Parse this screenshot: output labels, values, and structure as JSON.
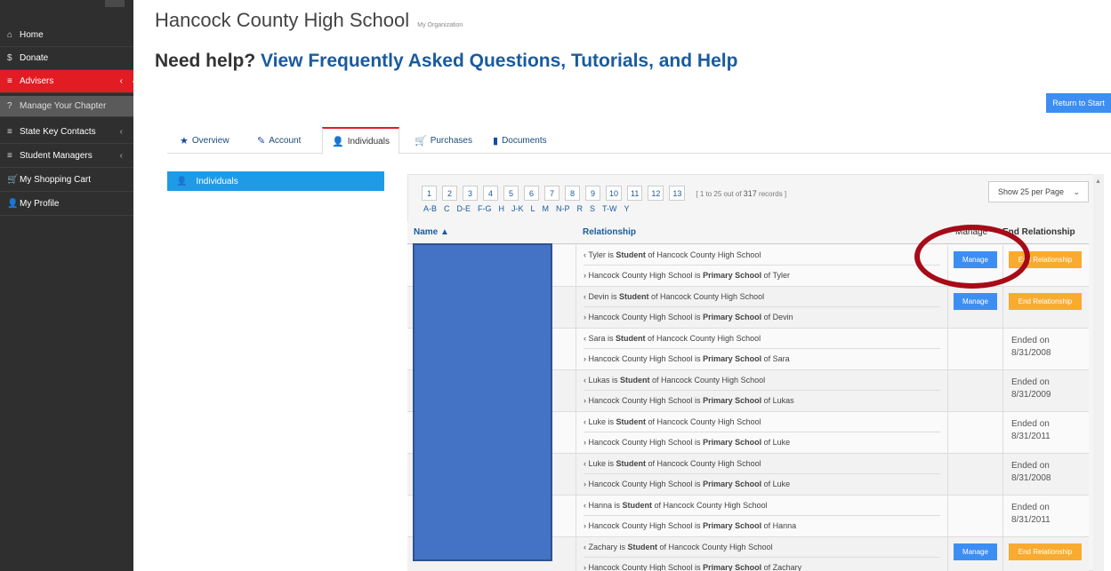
{
  "sidebar": {
    "items": [
      {
        "label": "Home",
        "icon": "home-icon",
        "glyph": "⌂"
      },
      {
        "label": "Donate",
        "icon": "dollar-icon",
        "glyph": "$"
      },
      {
        "label": "Advisers",
        "icon": "menu-icon",
        "glyph": "≡"
      },
      {
        "label": "Manage Your Chapter",
        "icon": "help-circle-icon",
        "glyph": "?"
      },
      {
        "label": "State Key Contacts",
        "icon": "menu-icon",
        "glyph": "≡"
      },
      {
        "label": "Student Managers",
        "icon": "menu-icon",
        "glyph": "≡"
      },
      {
        "label": "My Shopping Cart",
        "icon": "cart-icon",
        "glyph": "🛒"
      },
      {
        "label": "My Profile",
        "icon": "user-icon",
        "glyph": "👤"
      }
    ],
    "caret": "‹"
  },
  "header": {
    "org": "Hancock County High School",
    "org_sub": "My Organization",
    "help_prefix": "Need help?",
    "help_link": "View Frequently Asked Questions, Tutorials, and Help",
    "return_btn": "Return to Start"
  },
  "tabs": [
    {
      "label": "Overview",
      "icon": "star-icon",
      "glyph": "★"
    },
    {
      "label": "Account",
      "icon": "edit-icon",
      "glyph": "✎"
    },
    {
      "label": "Individuals",
      "icon": "user-icon",
      "glyph": "👤"
    },
    {
      "label": "Purchases",
      "icon": "cart-icon",
      "glyph": "🛒"
    },
    {
      "label": "Documents",
      "icon": "documents-icon",
      "glyph": "▮"
    }
  ],
  "left_panel": {
    "label": "Individuals",
    "icon": "user-icon",
    "glyph": "👤"
  },
  "pager": {
    "pages": [
      "1",
      "2",
      "3",
      "4",
      "5",
      "6",
      "7",
      "8",
      "9",
      "10",
      "11",
      "12",
      "13"
    ],
    "info_prefix": "[ 1 to 25",
    "info_mid": " out of ",
    "total": "317",
    "info_suffix": " records ]",
    "alpha": [
      "A-B",
      "C",
      "D-E",
      "F-G",
      "H",
      "J-K",
      "L",
      "M",
      "N-P",
      "R",
      "S",
      "T-W",
      "Y"
    ]
  },
  "select": {
    "value": "Show 25 per Page",
    "icon": "chevron-down-icon"
  },
  "table": {
    "headers": {
      "name": "Name ▲",
      "relationship": "Relationship",
      "manage": "Manage",
      "end": "End Relationship"
    },
    "manage_label": "Manage",
    "end_label": "End Relationship",
    "rows": [
      {
        "l1a": "‹ Tyler is ",
        "l1b": "Student",
        "l1c": " of Hancock County High School",
        "l2a": "› Hancock County High School is ",
        "l2b": "Primary School",
        "l2c": " of Tyler",
        "status": "active"
      },
      {
        "l1a": "‹ Devin is ",
        "l1b": "Student",
        "l1c": " of Hancock County High School",
        "l2a": "› Hancock County High School is ",
        "l2b": "Primary School",
        "l2c": " of Devin",
        "status": "active"
      },
      {
        "l1a": "‹ Sara is ",
        "l1b": "Student",
        "l1c": " of Hancock County High School",
        "l2a": "› Hancock County High School is ",
        "l2b": "Primary School",
        "l2c": " of Sara",
        "status": "ended",
        "ended": "Ended on",
        "date": "8/31/2008"
      },
      {
        "l1a": "‹ Lukas is ",
        "l1b": "Student",
        "l1c": " of Hancock County High School",
        "l2a": "› Hancock County High School is ",
        "l2b": "Primary School",
        "l2c": " of Lukas",
        "status": "ended",
        "ended": "Ended on",
        "date": "8/31/2009"
      },
      {
        "l1a": "‹ Luke is ",
        "l1b": "Student",
        "l1c": " of Hancock County High School",
        "l2a": "› Hancock County High School is ",
        "l2b": "Primary School",
        "l2c": " of Luke",
        "status": "ended",
        "ended": "Ended on",
        "date": "8/31/2011"
      },
      {
        "l1a": "‹ Luke is ",
        "l1b": "Student",
        "l1c": " of Hancock County High School",
        "l2a": "› Hancock County High School is ",
        "l2b": "Primary School",
        "l2c": " of Luke",
        "status": "ended",
        "ended": "Ended on",
        "date": "8/31/2008"
      },
      {
        "l1a": "‹ Hanna is ",
        "l1b": "Student",
        "l1c": " of Hancock County High School",
        "l2a": "› Hancock County High School is ",
        "l2b": "Primary School",
        "l2c": " of Hanna",
        "status": "ended",
        "ended": "Ended on",
        "date": "8/31/2011"
      },
      {
        "l1a": "‹ Zachary is ",
        "l1b": "Student",
        "l1c": " of Hancock County High School",
        "l2a": "› Hancock County High School is ",
        "l2b": "Primary School",
        "l2c": " of Zachary",
        "status": "active"
      }
    ]
  },
  "colors": {
    "sidebar_bg": "#2f2f2f",
    "active_red": "#e31b23",
    "link_blue": "#1a5b9c",
    "button_blue": "#3d8ef2",
    "end_orange": "#f9ab2f",
    "annotation_red": "#a60b17",
    "redaction_blue": "#4472c4"
  }
}
